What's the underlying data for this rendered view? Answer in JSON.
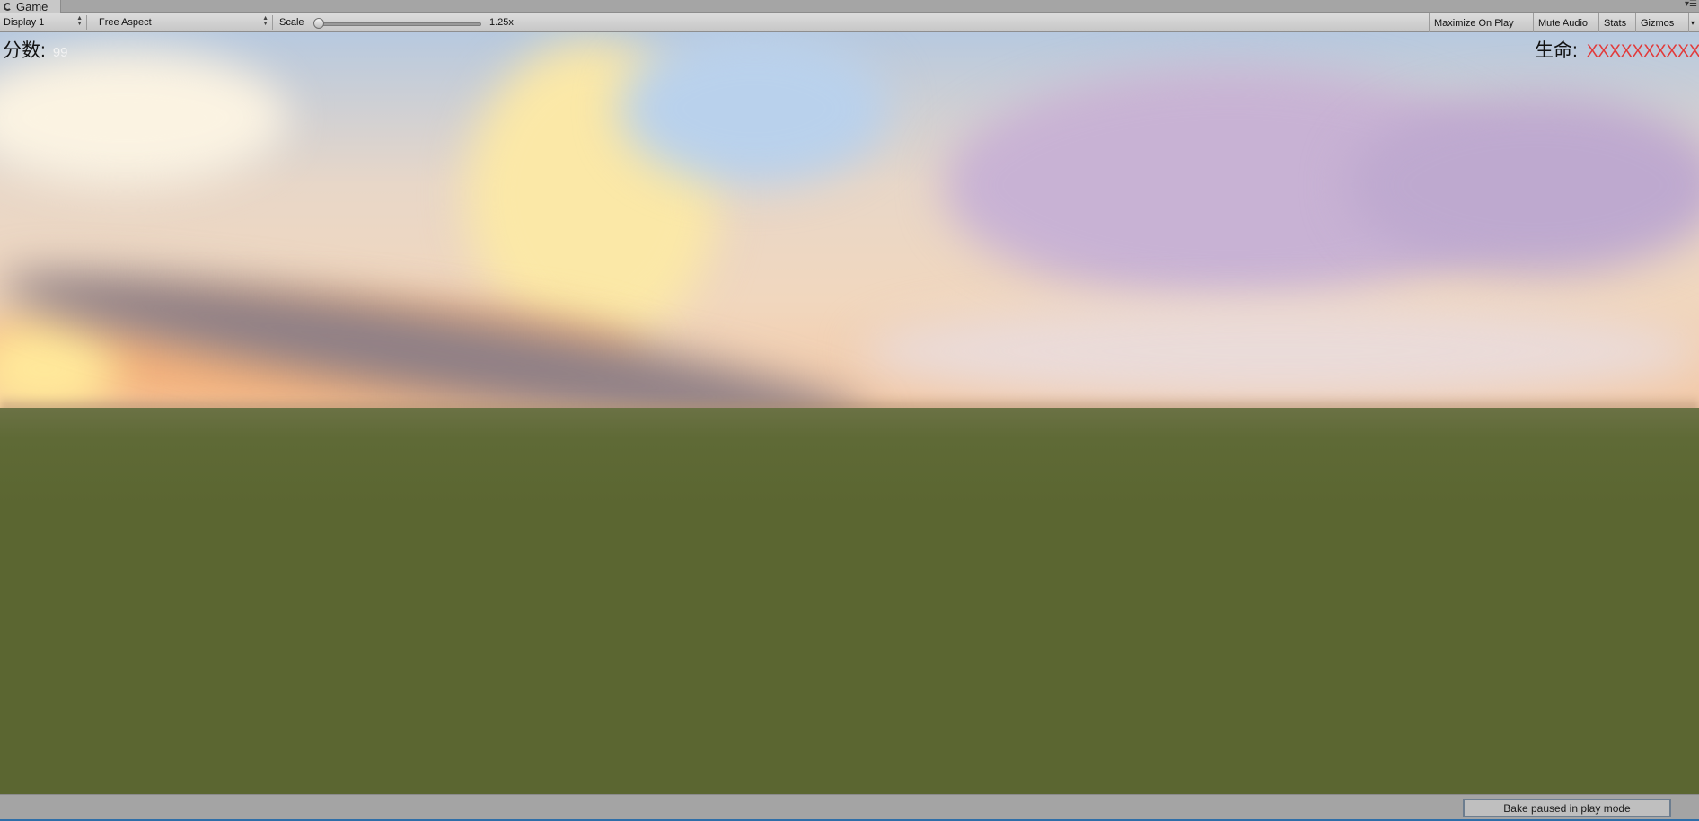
{
  "window": {
    "tab_title": "Game",
    "tab_icon": "game-controller-icon"
  },
  "toolbar": {
    "display": "Display 1",
    "aspect": "Free Aspect",
    "scale_label": "Scale",
    "scale_value": "1.25x",
    "maximize_on_play": "Maximize On Play",
    "mute_audio": "Mute Audio",
    "stats": "Stats",
    "gizmos": "Gizmos"
  },
  "hud": {
    "score_label": "分数:",
    "score_value": "99",
    "life_label": "生命:",
    "life_marks": "XXXXXXXXXXX"
  },
  "status": {
    "bake_message": "Bake paused in play mode"
  }
}
